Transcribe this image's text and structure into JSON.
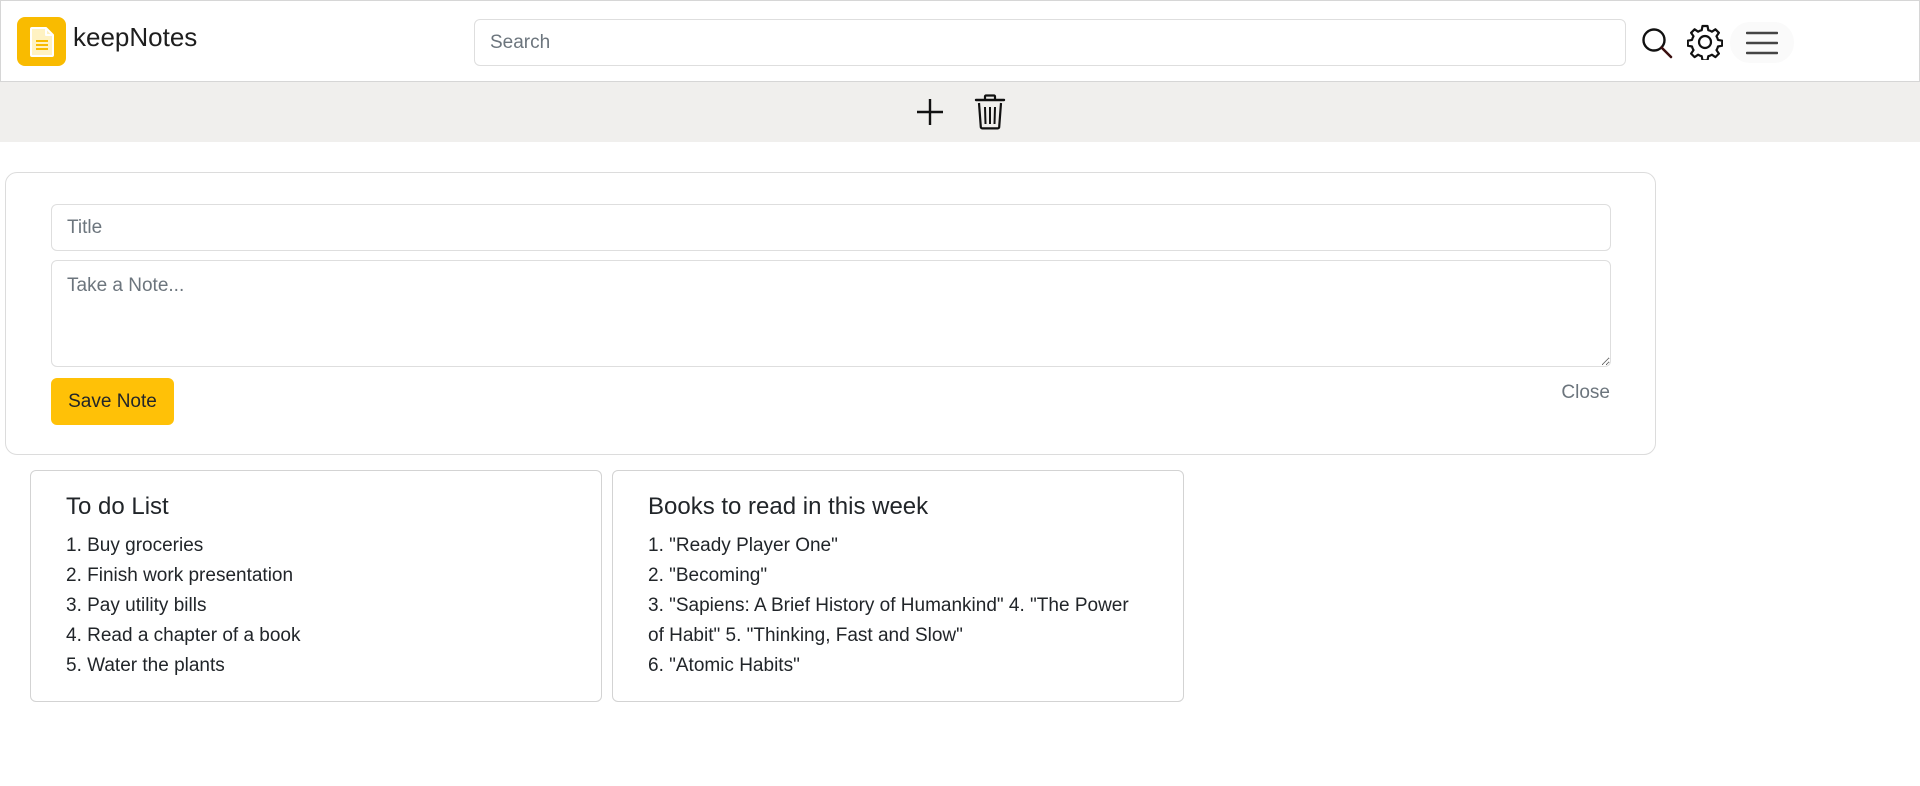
{
  "header": {
    "app_title": "keepNotes",
    "search": {
      "placeholder": "Search",
      "value": ""
    },
    "icons": {
      "logo": "note-icon",
      "search": "search-icon",
      "settings": "gear-icon",
      "menu": "hamburger-menu-icon"
    }
  },
  "toolbar": {
    "icons": {
      "add": "plus-icon",
      "delete": "trash-icon"
    }
  },
  "editor": {
    "title_placeholder": "Title",
    "title_value": "",
    "note_placeholder": "Take a Note...",
    "note_value": "",
    "save_label": "Save Note",
    "close_label": "Close"
  },
  "notes": [
    {
      "title": "To do List",
      "lines": [
        "1. Buy groceries",
        "2. Finish work presentation",
        "3. Pay utility bills",
        "4. Read a chapter of a book",
        "5. Water the plants"
      ]
    },
    {
      "title": "Books to read in this week",
      "lines": [
        "1. \"Ready Player One\"",
        "2. \"Becoming\"",
        "3. \"Sapiens: A Brief History of Humankind\" 4. \"The Power of Habit\" 5. \"Thinking, Fast and Slow\"",
        "6. \"Atomic Habits\""
      ]
    }
  ],
  "colors": {
    "brand": "#f9bb00",
    "save_button": "#ffc107",
    "toolbar_bg": "#f0efed",
    "muted_text": "#6c757d"
  }
}
